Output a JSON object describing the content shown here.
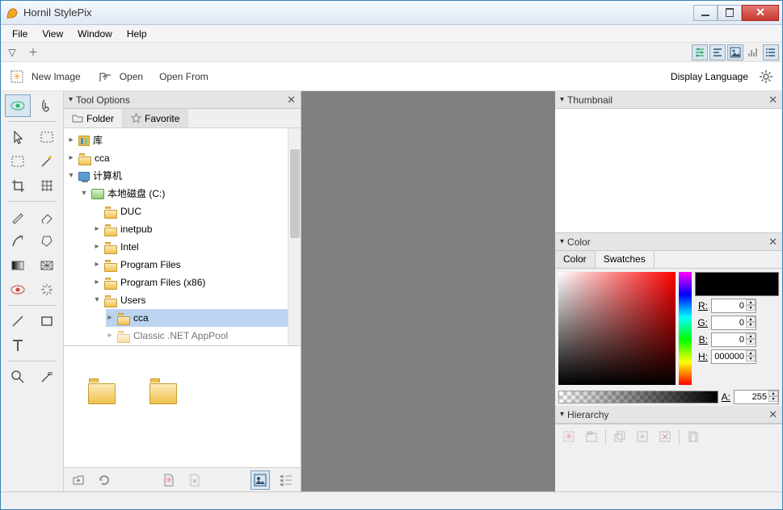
{
  "app": {
    "title": "Hornil StylePix"
  },
  "window_buttons": {
    "minimize": "min",
    "maximize": "max",
    "close": "close"
  },
  "menu": {
    "file": "File",
    "view": "View",
    "window": "Window",
    "help": "Help"
  },
  "actions": {
    "new_image": "New Image",
    "open": "Open",
    "open_from": "Open From",
    "display_language": "Display Language"
  },
  "panels": {
    "tool_options": {
      "title": "Tool Options",
      "tabs": {
        "folder": "Folder",
        "favorite": "Favorite"
      }
    },
    "thumbnail": {
      "title": "Thumbnail"
    },
    "color": {
      "title": "Color",
      "tabs": {
        "color": "Color",
        "swatches": "Swatches"
      },
      "labels": {
        "r": "R:",
        "g": "G:",
        "b": "B:",
        "h": "H:",
        "a": "A:"
      },
      "values": {
        "r": "0",
        "g": "0",
        "b": "0",
        "h": "000000",
        "a": "255"
      }
    },
    "hierarchy": {
      "title": "Hierarchy"
    }
  },
  "tree": {
    "items": [
      {
        "label": "库",
        "icon": "library",
        "expandable": true
      },
      {
        "label": "cca",
        "icon": "folder",
        "expandable": true
      },
      {
        "label": "计算机",
        "icon": "computer",
        "expanded": true,
        "children": [
          {
            "label": "本地磁盘 (C:)",
            "icon": "drive",
            "expanded": true,
            "children": [
              {
                "label": "DUC",
                "icon": "folder"
              },
              {
                "label": "inetpub",
                "icon": "folder",
                "expandable": true
              },
              {
                "label": "Intel",
                "icon": "folder",
                "expandable": true
              },
              {
                "label": "Program Files",
                "icon": "folder",
                "expandable": true
              },
              {
                "label": "Program Files (x86)",
                "icon": "folder",
                "expandable": true
              },
              {
                "label": "Users",
                "icon": "folder",
                "expanded": true,
                "children": [
                  {
                    "label": "cca",
                    "icon": "folder",
                    "expandable": true,
                    "selected": true
                  },
                  {
                    "label": "Classic .NET AppPool",
                    "icon": "folder",
                    "expandable": true,
                    "cut": true
                  }
                ]
              }
            ]
          }
        ]
      }
    ]
  },
  "toolbox": {
    "rows": [
      [
        "eye-tool",
        "clip-tool"
      ],
      [
        "pointer-tool",
        "rect-marquee-tool"
      ],
      [
        "lasso-tool",
        "magic-wand-tool"
      ],
      [
        "crop-tool",
        "grid-tool"
      ],
      [
        "brush-tool",
        "eraser-tool"
      ],
      [
        "heal-tool",
        "smudge-tool"
      ],
      [
        "gradient-tool",
        "pattern-tool"
      ],
      [
        "red-eye-tool",
        "exposure-tool"
      ],
      [
        "line-tool",
        "rectangle-tool"
      ],
      [
        "text-tool",
        "blank-tool"
      ],
      [
        "zoom-tool",
        "pan-tool"
      ]
    ]
  }
}
